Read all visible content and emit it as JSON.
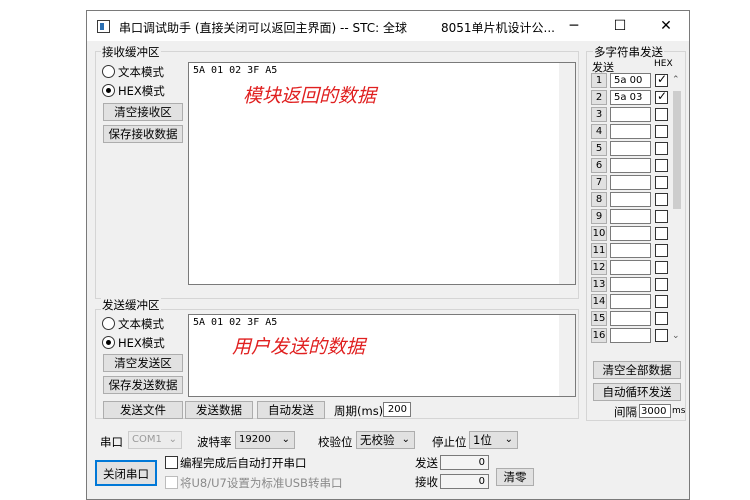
{
  "window": {
    "title": "串口调试助手 (直接关闭可以返回主界面) -- STC: 全球",
    "title_right": "8051单片机设计公...",
    "minimize": "─",
    "maximize": "☐",
    "close": "✕"
  },
  "receive": {
    "group_label": "接收缓冲区",
    "text_mode": "文本模式",
    "hex_mode": "HEX模式",
    "selected_mode": "hex",
    "clear_button": "清空接收区",
    "save_button": "保存接收数据",
    "content": "5A 01 02 3F A5",
    "overlay_text": "模块返回的数据"
  },
  "send": {
    "group_label": "发送缓冲区",
    "text_mode": "文本模式",
    "hex_mode": "HEX模式",
    "selected_mode": "hex",
    "clear_button": "清空发送区",
    "save_button": "保存发送数据",
    "content": "5A 01 02 3F A5",
    "overlay_text": "用户发送的数据",
    "send_file_button": "发送文件",
    "send_data_button": "发送数据",
    "auto_send_button": "自动发送",
    "period_label": "周期(ms)",
    "period_value": "200"
  },
  "multi": {
    "title": "多字符串发送",
    "col_send": "发送",
    "col_hex": "HEX",
    "rows": [
      {
        "num": "1",
        "value": "5a  00",
        "hex": true
      },
      {
        "num": "2",
        "value": "5a  03",
        "hex": true
      },
      {
        "num": "3",
        "value": "",
        "hex": false
      },
      {
        "num": "4",
        "value": "",
        "hex": false
      },
      {
        "num": "5",
        "value": "",
        "hex": false
      },
      {
        "num": "6",
        "value": "",
        "hex": false
      },
      {
        "num": "7",
        "value": "",
        "hex": false
      },
      {
        "num": "8",
        "value": "",
        "hex": false
      },
      {
        "num": "9",
        "value": "",
        "hex": false
      },
      {
        "num": "10",
        "value": "",
        "hex": false
      },
      {
        "num": "11",
        "value": "",
        "hex": false
      },
      {
        "num": "12",
        "value": "",
        "hex": false
      },
      {
        "num": "13",
        "value": "",
        "hex": false
      },
      {
        "num": "14",
        "value": "",
        "hex": false
      },
      {
        "num": "15",
        "value": "",
        "hex": false
      },
      {
        "num": "16",
        "value": "",
        "hex": false
      }
    ],
    "clear_all_button": "清空全部数据",
    "auto_loop_button": "自动循环发送",
    "interval_label": "间隔",
    "interval_value": "3000",
    "interval_unit": "ms"
  },
  "settings": {
    "port_label": "串口",
    "port_value": "COM1",
    "baud_label": "波特率",
    "baud_value": "19200",
    "parity_label": "校验位",
    "parity_value": "无校验",
    "stop_label": "停止位",
    "stop_value": "1位",
    "close_port_button": "关闭串口",
    "auto_open_label": "编程完成后自动打开串口",
    "usb_label": "将U8/U7设置为标准USB转串口",
    "sent_label": "发送",
    "sent_value": "0",
    "recv_label": "接收",
    "recv_value": "0",
    "zero_button": "清零"
  }
}
